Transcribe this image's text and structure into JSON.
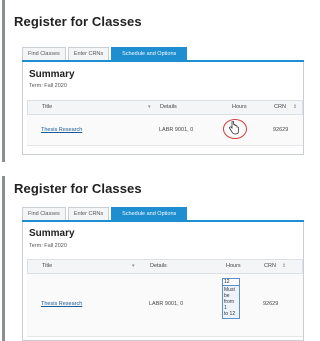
{
  "window": {
    "title": "Register for Classes"
  },
  "tabs": [
    {
      "label": "Find Classes"
    },
    {
      "label": "Enter CRNs"
    },
    {
      "label": "Schedule and Options"
    }
  ],
  "summary": {
    "title": "Summary",
    "term": "Term: Fall 2020"
  },
  "table": {
    "headers": {
      "title": "Title",
      "details": "Details",
      "hours": "Hours",
      "crn": "CRN"
    },
    "row": {
      "title": "Thesis Research",
      "details": "LABR 9001, 0",
      "crn": "92629"
    }
  },
  "editor": {
    "hours_value": "12",
    "error_lines": [
      "Must",
      "be",
      "from 1",
      "to 12"
    ]
  },
  "colors": {
    "accent": "#1d8ed0",
    "annotation": "#d23b3b",
    "link": "#1a5a96"
  },
  "icons": [
    "hand-cursor-icon",
    "sort-icon"
  ]
}
